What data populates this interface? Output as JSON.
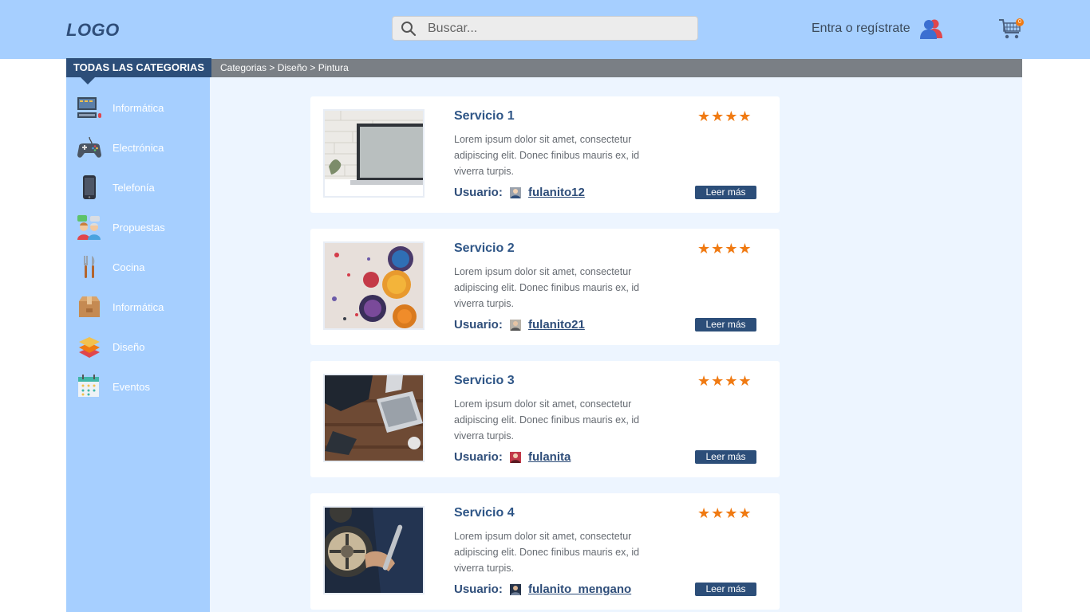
{
  "header": {
    "logo": "LOGO",
    "search_placeholder": "Buscar...",
    "login_label": "Entra o regístrate",
    "cart_count": "0"
  },
  "sidebar": {
    "heading": "TODAS LAS CATEGORIAS",
    "items": [
      {
        "label": "Informática",
        "icon": "computer-icon"
      },
      {
        "label": "Electrónica",
        "icon": "gamepad-icon"
      },
      {
        "label": "Telefonía",
        "icon": "phone-icon"
      },
      {
        "label": "Propuestas",
        "icon": "people-chat-icon"
      },
      {
        "label": "Cocina",
        "icon": "kitchen-utensils-icon"
      },
      {
        "label": "Informática",
        "icon": "box-icon"
      },
      {
        "label": "Diseño",
        "icon": "layers-icon"
      },
      {
        "label": "Eventos",
        "icon": "calendar-icon"
      }
    ]
  },
  "breadcrumb": "Categorias > Diseño > Pintura",
  "services": [
    {
      "title": "Servicio 1",
      "description": "Lorem ipsum dolor sit amet, consectetur adipiscing elit. Donec finibus mauris ex, id viverra turpis.",
      "user_label": "Usuario:",
      "username": "fulanito12",
      "stars": "★★★★",
      "more_label": "Leer más",
      "image": "laptop-on-brick-wall-photo"
    },
    {
      "title": "Servicio 2",
      "description": "Lorem ipsum dolor sit amet, consectetur adipiscing elit. Donec finibus mauris ex, id viverra turpis.",
      "user_label": "Usuario:",
      "username": "fulanito21",
      "stars": "★★★★",
      "more_label": "Leer más",
      "image": "paint-cans-photo"
    },
    {
      "title": "Servicio 3",
      "description": "Lorem ipsum dolor sit amet, consectetur adipiscing elit. Donec finibus mauris ex, id viverra turpis.",
      "user_label": "Usuario:",
      "username": "fulanita",
      "stars": "★★★★",
      "more_label": "Leer más",
      "image": "people-working-laptops-photo"
    },
    {
      "title": "Servicio 4",
      "description": "Lorem ipsum dolor sit amet, consectetur adipiscing elit. Donec finibus mauris ex, id viverra turpis.",
      "user_label": "Usuario:",
      "username": "fulanito_mengano",
      "stars": "★★★★",
      "more_label": "Leer más",
      "image": "mechanic-with-wheels-photo"
    }
  ],
  "colors": {
    "header_bg": "#a6cfff",
    "accent": "#2c4e79",
    "star": "#f07a12",
    "content_bg": "#edf5ff"
  }
}
